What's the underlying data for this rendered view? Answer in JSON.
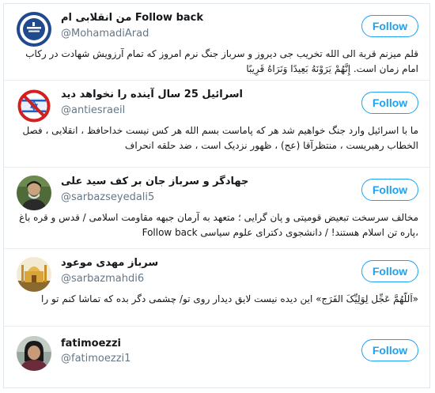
{
  "follow_label": "Follow",
  "accent_color": "#1da1f2",
  "users": [
    {
      "name": "من انقلابی ام Follow back",
      "handle": "@MohamadiArad",
      "bio": "قلم میزنم قربة الی الله تخریب جی دیروز و سرباز جنگ نرم امروز که تمام آرزویش شهادت در رکاب امام زمان است. إِنَّهُمْ يَرَوْنَهُ بَعِيدًا وَنَرَاهُ قَرِيبًا",
      "avatar_icon": "logo-badge-icon"
    },
    {
      "name": "اسرائیل 25 سال آینده را نخواهد دید",
      "handle": "@antiesraeil",
      "bio": "ما با اسرائیل وارد جنگ خواهیم شد هر که پاماست بسم الله هر کس نیست خداحافظ ، انقلابی ، فصل الخطاب رهبریست ، منتظرآقا (عج) ، ظهور نزدیک است ، ضد حلقه انحراف",
      "avatar_icon": "prohibited-flag-icon"
    },
    {
      "name": "جهادگر و سرباز جان بر کف سید علی",
      "handle": "@sarbazseyedali5",
      "bio": "مخالف سرسخت تبعیض قومیتی و پان گرایی ؛ متعهد به آرمان جبهه مقاومت اسلامی / قدس و قره باغ ،پاره تن اسلام هستند! / دانشجوی دکترای علوم سیاسی Follow back",
      "avatar_icon": "portrait-icon"
    },
    {
      "name": "سرباز مهدی موعود",
      "handle": "@sarbazmahdi6",
      "bio": "«اَللّهُمَّ عَجِّل لِوَلِیِّکَ الفَرَج» این دیده نیست لایق دیدار روی تو/ چشمی دگر بده که تماشا کنم تو را",
      "avatar_icon": "shrine-icon"
    },
    {
      "name": "fatimoezzi",
      "handle": "@fatimoezzi1",
      "bio": "",
      "avatar_icon": "portrait-icon"
    }
  ]
}
